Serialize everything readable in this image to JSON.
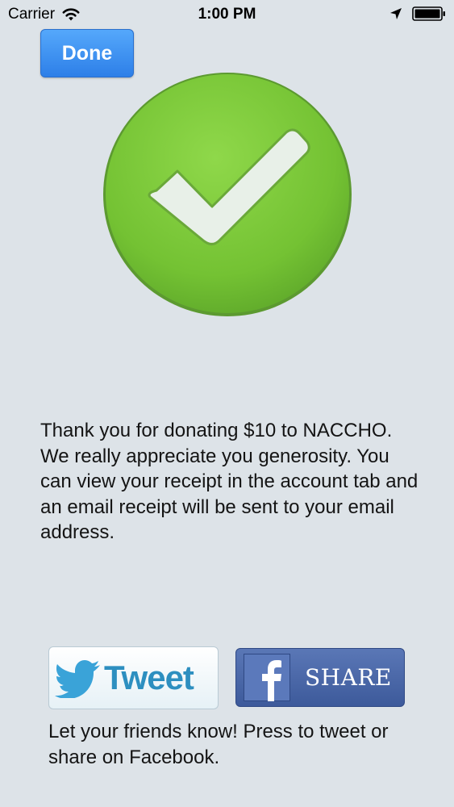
{
  "status_bar": {
    "carrier": "Carrier",
    "time": "1:00 PM",
    "icons": [
      "wifi-icon",
      "location-arrow-icon",
      "battery-icon"
    ]
  },
  "done_button": {
    "label": "Done"
  },
  "success_icon": "checkmark-circle-icon",
  "message": "Thank you for donating $10 to NACCHO. We really appreciate you generosity. You can view your receipt in the account tab and an email receipt will be sent to your email address.",
  "tweet_button": {
    "label": "Tweet",
    "icon": "twitter-bird-icon"
  },
  "share_button": {
    "label": "SHARE",
    "icon": "facebook-icon"
  },
  "footer": "Let your friends know! Press to tweet or share on Facebook.",
  "colors": {
    "background": "#dde3e8",
    "done_blue": "#2d7fe8",
    "check_green": "#7ecb3c",
    "twitter_blue": "#2d8fc0",
    "facebook_blue": "#3d5a9b"
  }
}
